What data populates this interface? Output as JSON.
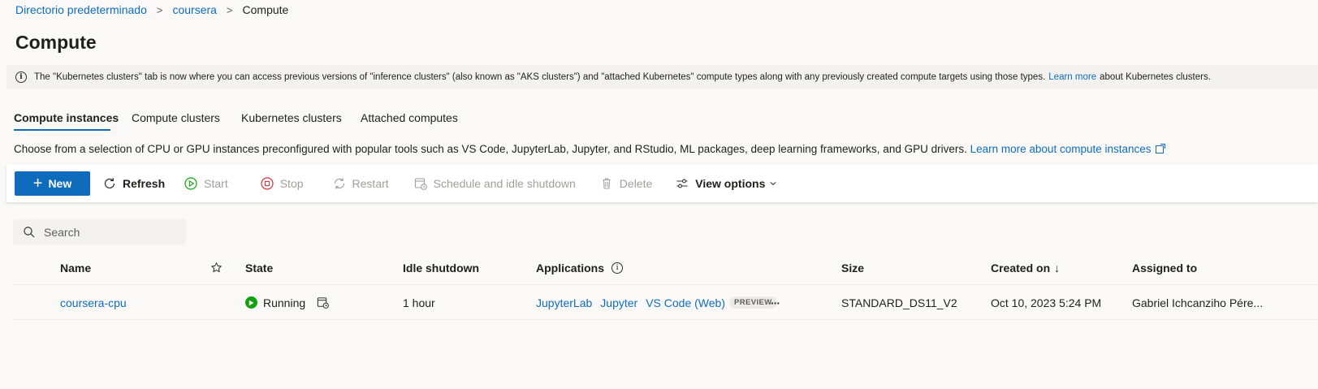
{
  "breadcrumb": {
    "items": [
      "Directorio predeterminado",
      "coursera"
    ],
    "current": "Compute",
    "separator": ">"
  },
  "page_title": "Compute",
  "info_bar": {
    "text": "The \"Kubernetes clusters\" tab is now where you can access previous versions of \"inference clusters\" (also known as \"AKS clusters\") and \"attached Kubernetes\" compute types along with any previously created compute targets using those types.",
    "link": "Learn more",
    "suffix": "about Kubernetes clusters."
  },
  "tabs": [
    "Compute instances",
    "Compute clusters",
    "Kubernetes clusters",
    "Attached computes"
  ],
  "active_tab": "Compute instances",
  "description": {
    "text": "Choose from a selection of CPU or GPU instances preconfigured with popular tools such as VS Code, JupyterLab, Jupyter, and RStudio, ML packages, deep learning frameworks, and GPU drivers.",
    "link": "Learn more about compute instances"
  },
  "toolbar": {
    "new": "New",
    "refresh": "Refresh",
    "start": "Start",
    "stop": "Stop",
    "restart": "Restart",
    "schedule": "Schedule and idle shutdown",
    "delete": "Delete",
    "view_options": "View options"
  },
  "search": {
    "placeholder": "Search"
  },
  "table": {
    "columns": {
      "name": "Name",
      "state": "State",
      "idle": "Idle shutdown",
      "applications": "Applications",
      "size": "Size",
      "created": "Created on",
      "created_sort": "↓",
      "assigned": "Assigned to"
    },
    "rows": [
      {
        "name": "coursera-cpu",
        "state": "Running",
        "idle": "1 hour",
        "apps": [
          "JupyterLab",
          "Jupyter",
          "VS Code (Web)"
        ],
        "preview_badge": "PREVIEW",
        "more": "···",
        "size": "STANDARD_DS11_V2",
        "created": "Oct 10, 2023 5:24 PM",
        "assigned": "Gabriel Ichcanziho Pére..."
      }
    ]
  },
  "colors": {
    "accent": "#0f6cbd",
    "running": "#13a10e",
    "stop": "#d13438",
    "start": "#13a10e",
    "disabled": "#a19f9d"
  }
}
